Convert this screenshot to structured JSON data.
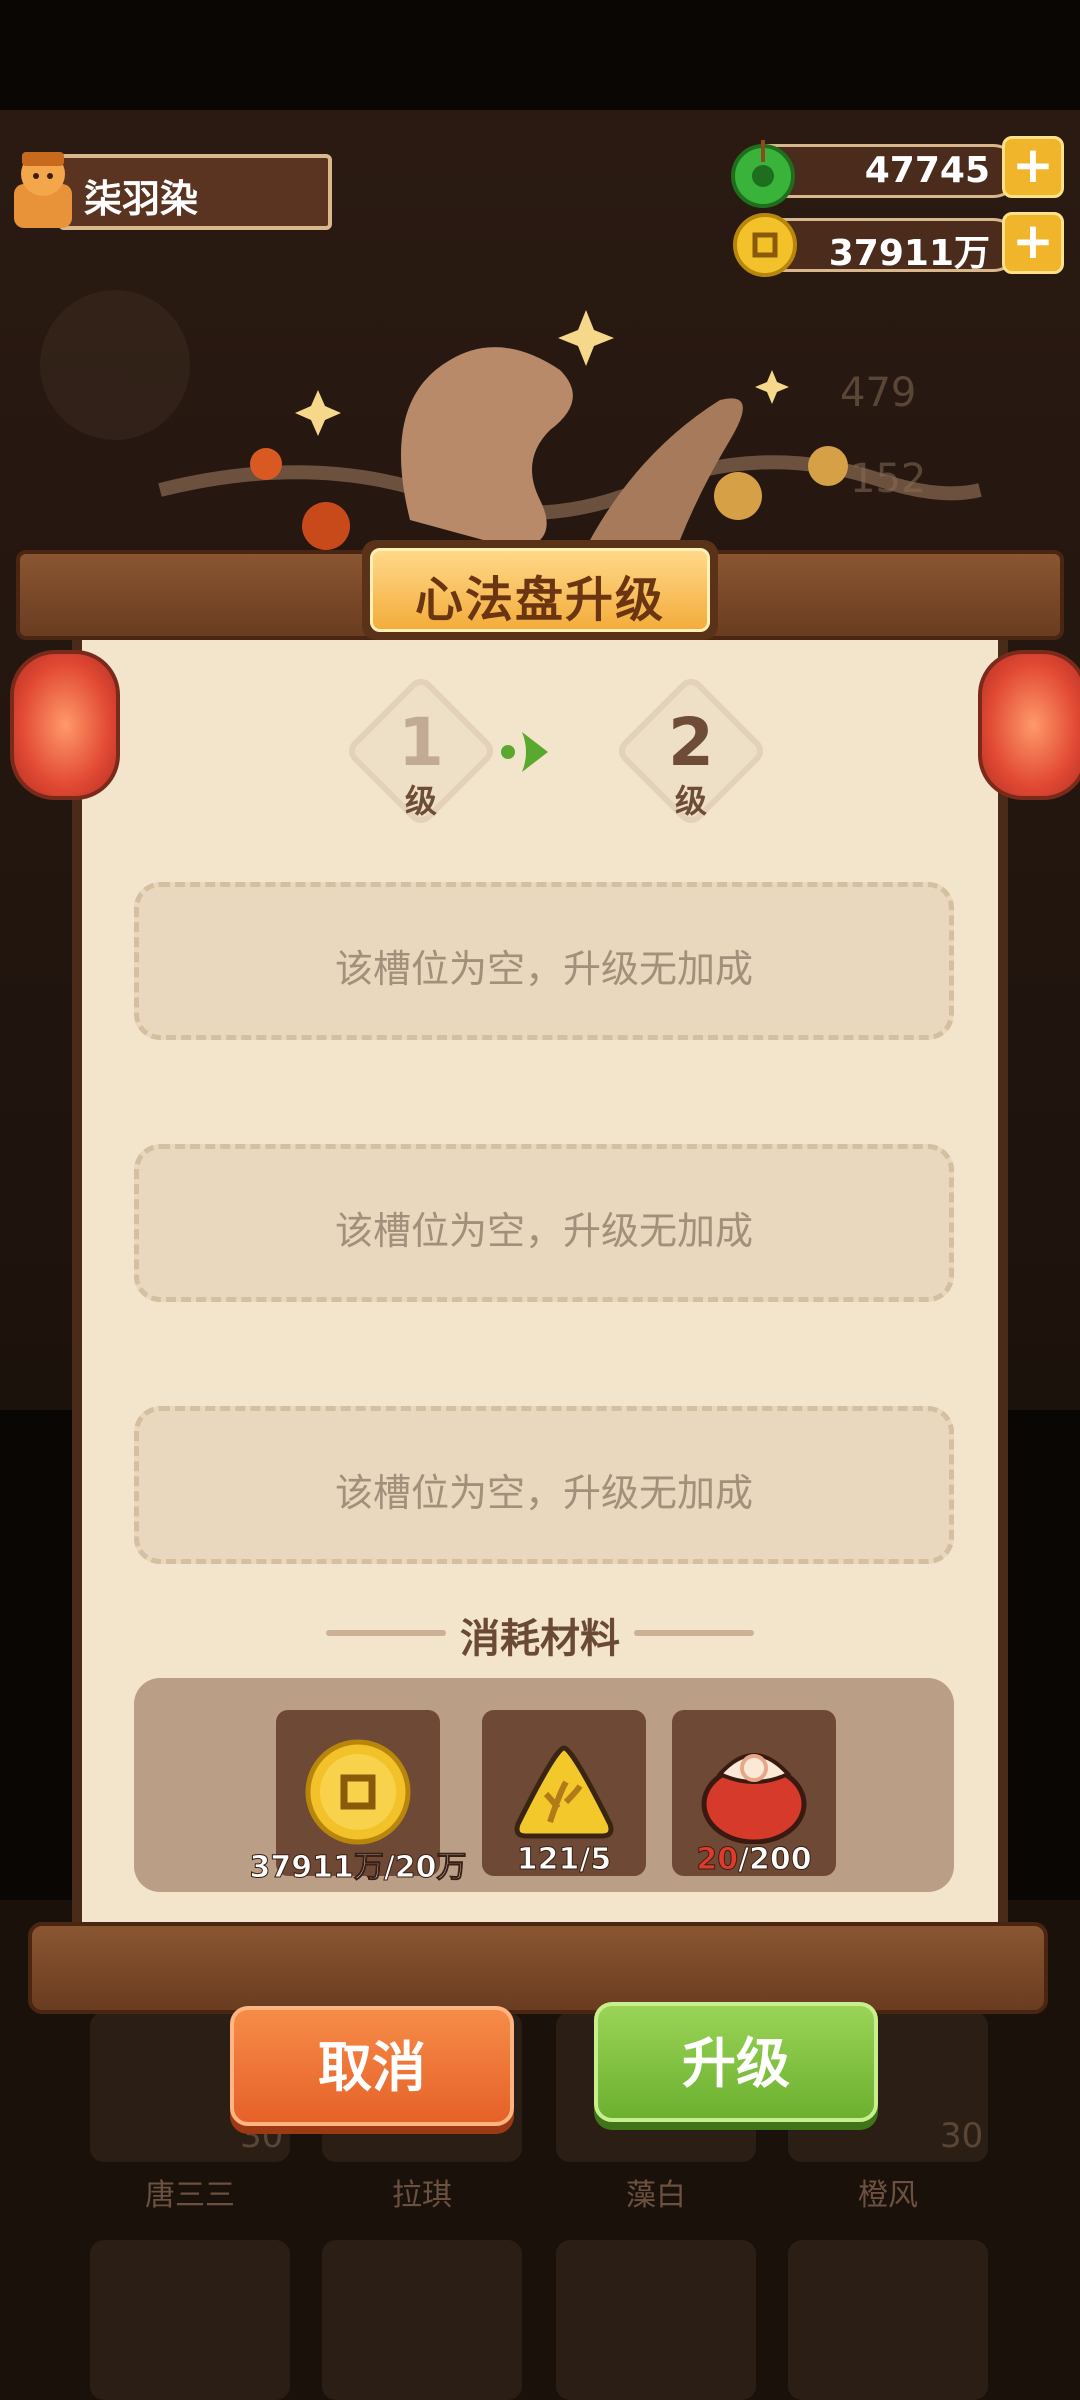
{
  "header": {
    "player_name": "柒羽染",
    "jade_amount": "47745",
    "coin_amount": "37911万"
  },
  "dialog": {
    "title": "心法盘升级",
    "level_from": "1",
    "level_to": "2",
    "level_unit": "级",
    "slots": [
      {
        "text": "该槽位为空，升级无加成"
      },
      {
        "text": "该槽位为空，升级无加成"
      },
      {
        "text": "该槽位为空，升级无加成"
      }
    ],
    "materials_title": "消耗材料",
    "materials": [
      {
        "icon": "coin-icon",
        "count": "37911万/20万"
      },
      {
        "icon": "triangle-badge-icon",
        "count": "121/5"
      },
      {
        "icon": "red-bag-icon",
        "have": "20",
        "need": "/200",
        "have_color": "#e03a2a"
      }
    ],
    "cancel_label": "取消",
    "upgrade_label": "升级"
  },
  "background": {
    "stat_1": "479",
    "stat_2": "152",
    "hero_names": [
      "唐三三",
      "拉琪",
      "藻白",
      "橙风"
    ],
    "hero_levels": [
      "30",
      "30"
    ]
  },
  "colors": {
    "cancel": "#e66128",
    "upgrade": "#6cb030",
    "title_plaque": "#f3ad3c",
    "panel": "#f3e5cc"
  }
}
